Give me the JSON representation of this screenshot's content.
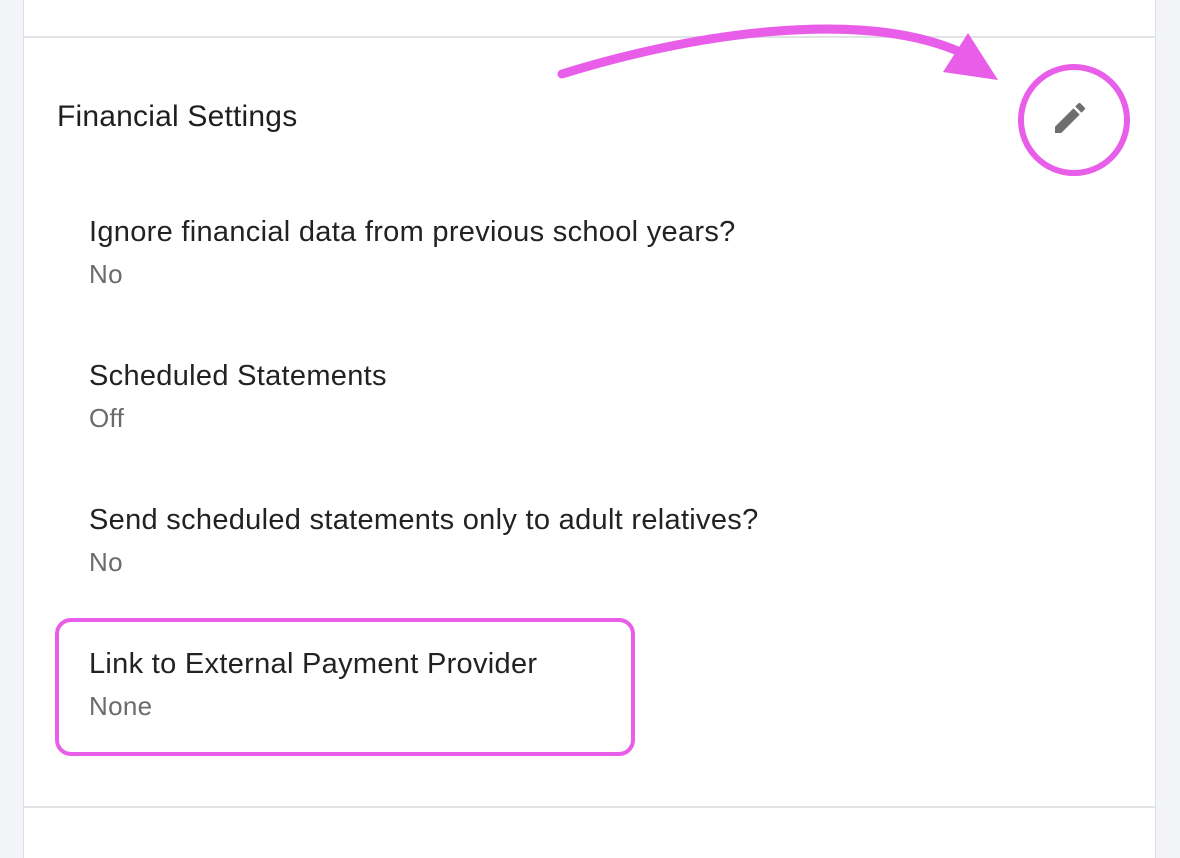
{
  "section": {
    "title": "Financial Settings",
    "edit_icon": "pencil-icon"
  },
  "settings": [
    {
      "label": "Ignore financial data from previous school years?",
      "value": "No"
    },
    {
      "label": "Scheduled Statements",
      "value": "Off"
    },
    {
      "label": "Send scheduled statements only to adult relatives?",
      "value": "No"
    },
    {
      "label": "Link to External Payment Provider",
      "value": "None"
    }
  ],
  "annotation": {
    "color": "#e85ee9"
  }
}
